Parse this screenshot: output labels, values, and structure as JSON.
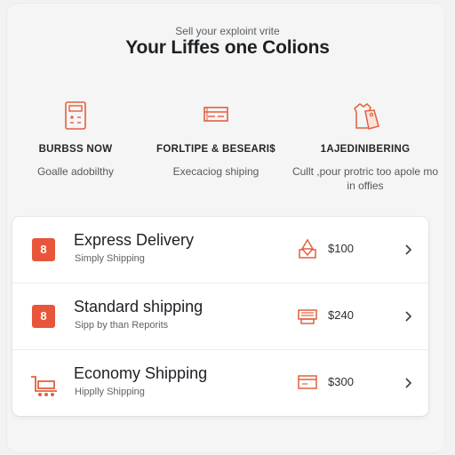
{
  "header": {
    "subtitle": "Sell your exploint vrite",
    "title": "Your Liffes one Colions"
  },
  "features": [
    {
      "icon": "calculator-icon",
      "title": "BURBSS NOW",
      "desc": "Goalle adobilthy"
    },
    {
      "icon": "card-stack-icon",
      "title": "FORLTIPE & BESEARI$",
      "desc": "Execaciog shiping"
    },
    {
      "icon": "shirt-tag-icon",
      "title": "1AJEDINIBERING",
      "desc": "Cullt ,pour protric too apole mo in offies"
    }
  ],
  "options": [
    {
      "badge": "8",
      "name": "Express Delivery",
      "sub": "Simply Shipping",
      "icon": "box-pyramid-icon",
      "price": "$100"
    },
    {
      "badge": "8",
      "name": "Standard shipping",
      "sub": "Sipp by than Reporits",
      "icon": "cash-register-icon",
      "price": "$240"
    },
    {
      "badge": "",
      "name": "Economy Shipping",
      "sub": "Hipplly Shipping",
      "icon": "cart-icon",
      "price": "$300"
    }
  ],
  "colors": {
    "accent": "#e8553b",
    "background": "#f1f2f1",
    "card": "#ffffff"
  }
}
